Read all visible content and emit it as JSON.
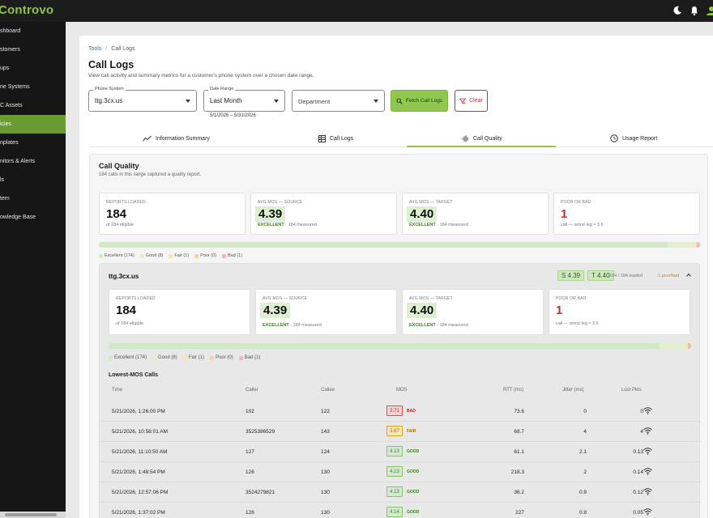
{
  "app": {
    "brand": "Controvo"
  },
  "sidebar": {
    "items": [
      {
        "label": "shboard"
      },
      {
        "label": "stomers"
      },
      {
        "label": "ups"
      },
      {
        "label": "ne Systems"
      },
      {
        "label": "C Assets"
      },
      {
        "label": "icies"
      },
      {
        "label": "nplates"
      },
      {
        "label": "nitors & Alerts"
      },
      {
        "label": "ls"
      },
      {
        "label": "tem"
      },
      {
        "label": "owledge Base"
      }
    ]
  },
  "breadcrumb": {
    "parent": "Tools",
    "sep": "/",
    "current": "Call Logs"
  },
  "page": {
    "title": "Call Logs",
    "subtitle": "View call activity and summary metrics for a customer's phone system over a chosen date range."
  },
  "filters": {
    "phone_system": {
      "label": "Phone System",
      "value": "ttg.3cx.us"
    },
    "date_range": {
      "label": "Date Range",
      "value": "Last Month",
      "range_text": "5/1/2026 – 5/31/2026"
    },
    "department": {
      "placeholder": "Department"
    },
    "fetch_label": "Fetch Call Logs",
    "clear_label": "Clear"
  },
  "tabs": [
    {
      "label": "Information Summary"
    },
    {
      "label": "Call Logs"
    },
    {
      "label": "Call Quality"
    },
    {
      "label": "Usage Report"
    }
  ],
  "call_quality": {
    "title": "Call Quality",
    "subtitle": "184 calls in this range captured a quality report.",
    "stats": {
      "reports": {
        "label": "REPORTS LOADED",
        "value": "184",
        "sub": "of 184 eligible"
      },
      "mos_source": {
        "label": "AVG MOS — SOURCE",
        "value": "4.39",
        "grade": "EXCELLENT",
        "sub": "· 184 measured"
      },
      "mos_target": {
        "label": "AVG MOS — TARGET",
        "value": "4.40",
        "grade": "EXCELLENT",
        "sub": "· 184 measured"
      },
      "poor": {
        "label": "POOR OR BAD",
        "value": "1",
        "sub": "call — worst leg ≈ 3.6"
      }
    },
    "distribution": {
      "excellent": 174,
      "good": 8,
      "fair": 1,
      "poor": 0,
      "bad": 1
    },
    "legend": [
      "Excellent (174)",
      "Good (8)",
      "Fair (1)",
      "Poor (0)",
      "Bad (1)"
    ],
    "colors": {
      "excellent": "#d3e8c6",
      "good": "#e4efcf",
      "fair": "#f2e7b7",
      "poor": "#f2d2b0",
      "bad": "#f0b9b9"
    }
  },
  "system": {
    "name": "ttg.3cx.us",
    "source_badge": "S 4.39",
    "target_badge": "T 4.40",
    "loaded": "184 / 184 loaded",
    "poor_text": "1 poor/bad",
    "stats": {
      "reports": {
        "label": "REPORTS LOADED",
        "value": "184",
        "sub": "of 184 eligible"
      },
      "mos_source": {
        "label": "AVG MOS — SOURCE",
        "value": "4.39",
        "grade": "EXCELLENT",
        "sub": "· 184 measured"
      },
      "mos_target": {
        "label": "AVG MOS — TARGET",
        "value": "4.40",
        "grade": "EXCELLENT",
        "sub": "· 184 measured"
      },
      "poor": {
        "label": "POOR OR BAD",
        "value": "1",
        "sub": "call — worst leg ≈ 3.6"
      }
    },
    "legend": [
      "Excellent (174)",
      "Good (8)",
      "Fair (1)",
      "Poor (0)",
      "Bad (1)"
    ],
    "lowest_title": "Lowest-MOS Calls",
    "columns": [
      "Time",
      "Caller",
      "Callee",
      "MOS",
      "RTT (ms)",
      "Jitter (ms)",
      "Lost Pkts"
    ],
    "rows": [
      {
        "time": "5/21/2026, 1:26:00 PM",
        "caller": "102",
        "callee": "122",
        "mos": "2.71",
        "grade": "BAD",
        "rtt": "73.6",
        "jitter": "0",
        "lost": "0"
      },
      {
        "time": "5/21/2026, 10:58:01 AM",
        "caller": "3525386529",
        "callee": "143",
        "mos": "3.87",
        "grade": "FAIR",
        "rtt": "68.7",
        "jitter": "4",
        "lost": "4"
      },
      {
        "time": "5/21/2026, 11:10:50 AM",
        "caller": "127",
        "callee": "124",
        "mos": "4.13",
        "grade": "GOOD",
        "rtt": "61.1",
        "jitter": "2.1",
        "lost": "0.13"
      },
      {
        "time": "5/21/2026, 1:48:54 PM",
        "caller": "126",
        "callee": "130",
        "mos": "4.13",
        "grade": "GOOD",
        "rtt": "218.3",
        "jitter": "2",
        "lost": "0.14"
      },
      {
        "time": "5/21/2026, 12:57:06 PM",
        "caller": "3524279821",
        "callee": "130",
        "mos": "4.13",
        "grade": "GOOD",
        "rtt": "36.2",
        "jitter": "0.9",
        "lost": "0.12"
      },
      {
        "time": "5/21/2026, 1:37:02 PM",
        "caller": "126",
        "callee": "130",
        "mos": "4.14",
        "grade": "GOOD",
        "rtt": "227",
        "jitter": "0.9",
        "lost": "0.05"
      }
    ]
  }
}
